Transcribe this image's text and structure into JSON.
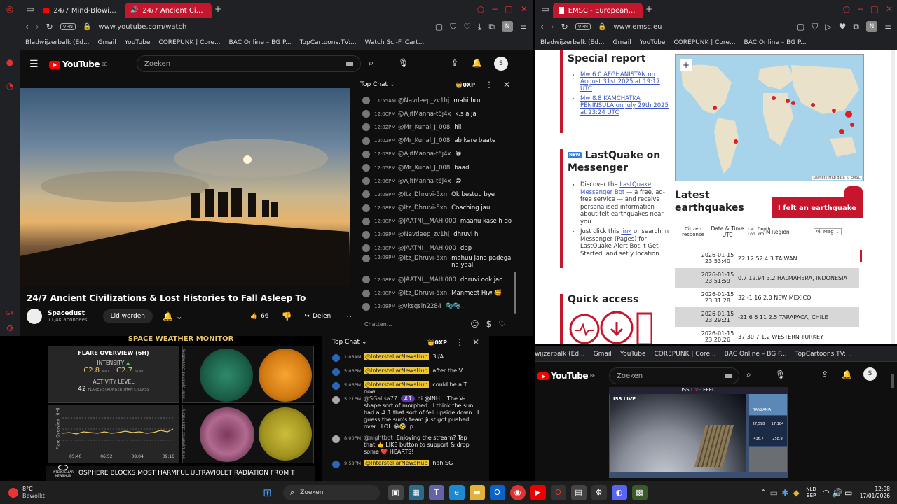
{
  "left_window": {
    "tabs": [
      {
        "label": "24/7 Mind-Blowing Space"
      },
      {
        "label": "24/7 Ancient Civilizatio"
      }
    ],
    "url": "www.youtube.com/watch",
    "bookmarks": [
      "Bladwijzerbalk (Ed...",
      "Gmail",
      "YouTube",
      "COREPUNK | Core...",
      "BAC Online – BG P...",
      "TopCartoons.TV:...",
      "Watch Sci-Fi Cart..."
    ],
    "search_placeholder": "Zoeken",
    "avatar_letter": "S",
    "logo_text": "YouTube",
    "logo_region": "BE",
    "video": {
      "title": "24/7 Ancient Civilizations & Lost Histories to Fall Asleep To",
      "channel": "Spacedust",
      "subscribers": "71,4K abonnees",
      "join_label": "Lid worden",
      "likes": "66",
      "share_label": "Delen"
    },
    "chat": {
      "title": "Top Chat",
      "points": "0XP",
      "input_placeholder": "Chatten...",
      "messages": [
        {
          "time": "11:55AM",
          "user": "@Navdeep_zv1hj",
          "text": "mahi hru"
        },
        {
          "time": "12:00PM",
          "user": "@AjitManna-t6j4x",
          "text": "k.s a ja"
        },
        {
          "time": "12:02PM",
          "user": "@Mr_Kunal_J_008",
          "text": "hii"
        },
        {
          "time": "12:02PM",
          "user": "@Mr_Kunal_J_008",
          "text": "ab kare baate"
        },
        {
          "time": "12:03PM",
          "user": "@AjitManna-t6j4x",
          "text": "😁"
        },
        {
          "time": "12:05PM",
          "user": "@Mr_Kunal_J_008",
          "text": "baad"
        },
        {
          "time": "12:06PM",
          "user": "@AjitManna-t6j4x",
          "text": "😁"
        },
        {
          "time": "12:08PM",
          "user": "@Itz_Dhruvi-5xn",
          "text": "Ok bestuu bye"
        },
        {
          "time": "12:08PM",
          "user": "@Itz_Dhruvi-5xn",
          "text": "Coaching jau"
        },
        {
          "time": "12:08PM",
          "user": "@JAATNI__MAHI000",
          "text": "maanu kase h do"
        },
        {
          "time": "12:08PM",
          "user": "@Navdeep_zv1hj",
          "text": "dhruvi hi"
        },
        {
          "time": "12:08PM",
          "user": "@JAATNI__MAHI000",
          "text": "dpp"
        },
        {
          "time": "12:08PM",
          "user": "@Itz_Dhruvi-5xn",
          "text": "mahuu Jana padega na yaal"
        },
        {
          "time": "12:08PM",
          "user": "@JAATNI__MAHI000",
          "text": "dhruvi ook jao"
        },
        {
          "time": "12:08PM",
          "user": "@Itz_Dhruvi-5xn",
          "text": "Manmeet Hiw 🥰"
        },
        {
          "time": "12:08PM",
          "user": "@vksgsin2284",
          "text": "🫧🫧"
        }
      ]
    }
  },
  "right_window": {
    "tab": "EMSC - European-Mediter",
    "url": "www.emsc.eu",
    "bookmarks": [
      "Bladwijzerbalk (Ed...",
      "Gmail",
      "YouTube",
      "COREPUNK | Core...",
      "BAC Online – BG P..."
    ],
    "special_report_title": "Special report",
    "reports": [
      "Mw 6.0 AFGHANISTAN on August 31st 2025 at 19:17 UTC",
      "Mw 8.8 KAMCHATKA PENINSULA on July 29th 2025 at 23:24 UTC"
    ],
    "lastquake_badge": "NEW",
    "lastquake_title": "LastQuake on Messenger",
    "lastquake_text_1": "Discover the",
    "lastquake_link": "LastQuake Messenger Bot",
    "lastquake_text_2": "— a free, ad-free service — and receive personalised information about felt earthquakes near you.",
    "lastquake_text_3": "Just click this",
    "lastquake_link2": "link",
    "lastquake_text_4": "or search in Messenger (Pages) for LastQuake Alert Bot, t Get Started, and set y location.",
    "quick_access": "Quick access",
    "map_attribution": "Leaflet | Map data © EMSC",
    "latest_title": "Latest earthquakes",
    "felt_button": "I felt an earthquake",
    "table_headers": {
      "citizen": "Citizen response",
      "date": "Date & Time UTC",
      "latlon": "Lat Lon",
      "depth": "Depth km",
      "mag": "M",
      "region": "Region",
      "filter": "All Mag"
    },
    "quakes": [
      {
        "date": "2026-01-15",
        "time": "23:53:40",
        "data": "22.12 52 4.3 TAIWAN"
      },
      {
        "date": "2026-01-15",
        "time": "23:51:59",
        "data": "0.7 12.94 3.2 HALMAHERA, INDONESIA"
      },
      {
        "date": "2026-01-15",
        "time": "23:31:28",
        "data": "32.-1 16 2.0 NEW MEXICO"
      },
      {
        "date": "2026-01-15",
        "time": "23:29:21",
        "data": "-21.6 6 11 2.5 TARAPACA, CHILE"
      },
      {
        "date": "2026-01-15",
        "time": "23:20:26",
        "data": "37.30 7 1.2 WESTERN TURKEY"
      }
    ]
  },
  "bottom_left": {
    "monitor_title": "SPACE WEATHER MONITOR",
    "flare_title": "FLARE OVERVIEW (6H)",
    "intensity_label": "INTENSITY",
    "intensity_max": "C2.8",
    "max_label": "MAX",
    "intensity_now": "C2.7",
    "now_label": "NOW",
    "activity_label": "ACTIVITY LEVEL",
    "activity_count": "42",
    "activity_text": "FLARES STRONGER THAN C-CLASS",
    "sdo_label": "Solar Dynamics Observatory",
    "flare_overview_side": "Flare Overview (6H)",
    "chart_times": [
      "05:40",
      "06:52",
      "08:04",
      "09:16"
    ],
    "ticker": "OSPHERE BLOCKS MOST HARMFUL ULTRAVIOLET RADIATION FROM T",
    "channel_logo": "INTERSTELLAR NEWS HUB",
    "chat": {
      "title": "Top Chat",
      "points": "0XP",
      "messages": [
        {
          "time": "1:08AM",
          "user": "@InterstellarNewsHub",
          "text": "3I/A..."
        },
        {
          "time": "5:06PM",
          "user": "@InterstellarNewsHub",
          "text": "after the V"
        },
        {
          "time": "5:06PM",
          "user": "@InterstellarNewsHub",
          "text": "could be a T now"
        },
        {
          "time": "5:21PM",
          "user": "@SGalisa77",
          "badge": "#1",
          "text": "hi @INH .. The V-shape sort of morphed.. I think the sun had a # 1 that sort of fell upside down.. I guess the sun's team just got pushed over.. LOL 😁🤣 :p"
        },
        {
          "time": "8:00PM",
          "user": "@nightbot",
          "text": "Enjoying the stream? Tap that 👍 LIKE button to support & drop some ❤️ HEARTS!"
        },
        {
          "time": "9:58PM",
          "user": "@InterstellarNewsHub",
          "text": "hah SG"
        }
      ]
    }
  },
  "bottom_right": {
    "bookmarks": [
      "wijzerbalk (Ed...",
      "Gmail",
      "YouTube",
      "COREPUNK | Core...",
      "BAC Online – BG P...",
      "TopCartoons.TV:..."
    ],
    "search_placeholder": "Zoeken",
    "avatar_letter": "S",
    "iss_feed_title_1": "ISS",
    "iss_feed_title_2": "LIVE",
    "iss_feed_title_3": "FEED",
    "iss_live_badge": "ISS LIVE",
    "country_label": "TANZANIA",
    "stats": [
      "27,598",
      "17,184",
      "436.7",
      "258.9"
    ]
  },
  "taskbar": {
    "temp": "8°C",
    "weather": "Bewolkt",
    "search_label": "Zoeken",
    "lang_1": "NLD",
    "lang_2": "BEP",
    "time": "12:08",
    "date": "17/01/2026"
  },
  "colors": {
    "accent_red": "#c5162e",
    "yt_red": "#ff0000",
    "emsc_red": "#c5162e"
  }
}
